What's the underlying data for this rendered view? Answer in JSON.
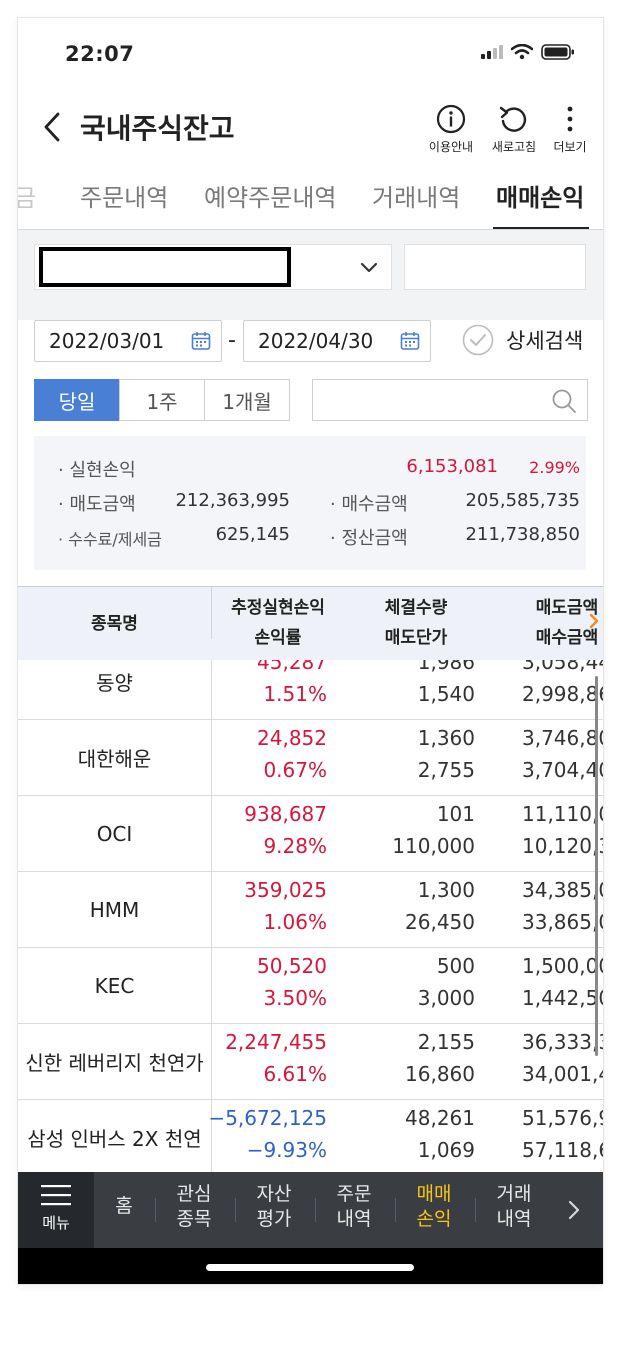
{
  "status": {
    "time": "22:07"
  },
  "header": {
    "title": "국내주식잔고",
    "info_label": "이용안내",
    "refresh_label": "새로고침",
    "more_label": "더보기"
  },
  "tabs": [
    {
      "label": "금"
    },
    {
      "label": "주문내역"
    },
    {
      "label": "예약주문내역"
    },
    {
      "label": "거래내역"
    },
    {
      "label": "매매손익"
    }
  ],
  "filters": {
    "start_date": "2022/03/01",
    "date_separator": "-",
    "end_date": "2022/04/30",
    "detail_search_label": "상세검색",
    "periods": [
      "당일",
      "1주",
      "1개월"
    ]
  },
  "summary": {
    "realized_pl_label": "실현손익",
    "realized_pl_value": "6,153,081",
    "realized_pl_rate": "2.99%",
    "sell_amount_label": "매도금액",
    "sell_amount_value": "212,363,995",
    "buy_amount_label": "매수금액",
    "buy_amount_value": "205,585,735",
    "fee_tax_label": "수수료/제세금",
    "fee_tax_value": "625,145",
    "settlement_label": "정산금액",
    "settlement_value": "211,738,850"
  },
  "table": {
    "headers": {
      "name": "종목명",
      "col1_line1": "추정실현손익",
      "col1_line2": "손익률",
      "col2_line1": "체결수량",
      "col2_line2": "매도단가",
      "col3_line1": "매도금액",
      "col3_line2": "매수금액"
    },
    "rows": [
      {
        "name": "동양",
        "pl": "45,287",
        "rate": "1.51%",
        "qty": "1,986",
        "price": "1,540",
        "sell": "3,058,44",
        "buy": "2,998,86",
        "sign": "pos"
      },
      {
        "name": "대한해운",
        "pl": "24,852",
        "rate": "0.67%",
        "qty": "1,360",
        "price": "2,755",
        "sell": "3,746,80",
        "buy": "3,704,40",
        "sign": "pos"
      },
      {
        "name": "OCI",
        "pl": "938,687",
        "rate": "9.28%",
        "qty": "101",
        "price": "110,000",
        "sell": "11,110,00",
        "buy": "10,120,30",
        "sign": "pos"
      },
      {
        "name": "HMM",
        "pl": "359,025",
        "rate": "1.06%",
        "qty": "1,300",
        "price": "26,450",
        "sell": "34,385,00",
        "buy": "33,865,00",
        "sign": "pos"
      },
      {
        "name": "KEC",
        "pl": "50,520",
        "rate": "3.50%",
        "qty": "500",
        "price": "3,000",
        "sell": "1,500,00",
        "buy": "1,442,50",
        "sign": "pos"
      },
      {
        "name": "신한 레버리지 천연가",
        "pl": "2,247,455",
        "rate": "6.61%",
        "qty": "2,155",
        "price": "16,860",
        "sell": "36,333,30",
        "buy": "34,001,45",
        "sign": "pos"
      },
      {
        "name": "삼성 인버스 2X 천연",
        "pl": "−5,672,125",
        "rate": "−9.93%",
        "qty": "48,261",
        "price": "1,069",
        "sell": "51,576,94",
        "buy": "57,118,65",
        "sign": "neg"
      }
    ]
  },
  "bottom_nav": {
    "menu": "메뉴",
    "items": [
      {
        "l1": "홈",
        "l2": ""
      },
      {
        "l1": "관심",
        "l2": "종목"
      },
      {
        "l1": "자산",
        "l2": "평가"
      },
      {
        "l1": "주문",
        "l2": "내역"
      },
      {
        "l1": "매매",
        "l2": "손익"
      },
      {
        "l1": "거래",
        "l2": "내역"
      }
    ]
  },
  "colors": {
    "positive": "#d4173b",
    "negative": "#2f62c6",
    "accent": "#4a7fd6",
    "nav_active": "#f5c518"
  }
}
